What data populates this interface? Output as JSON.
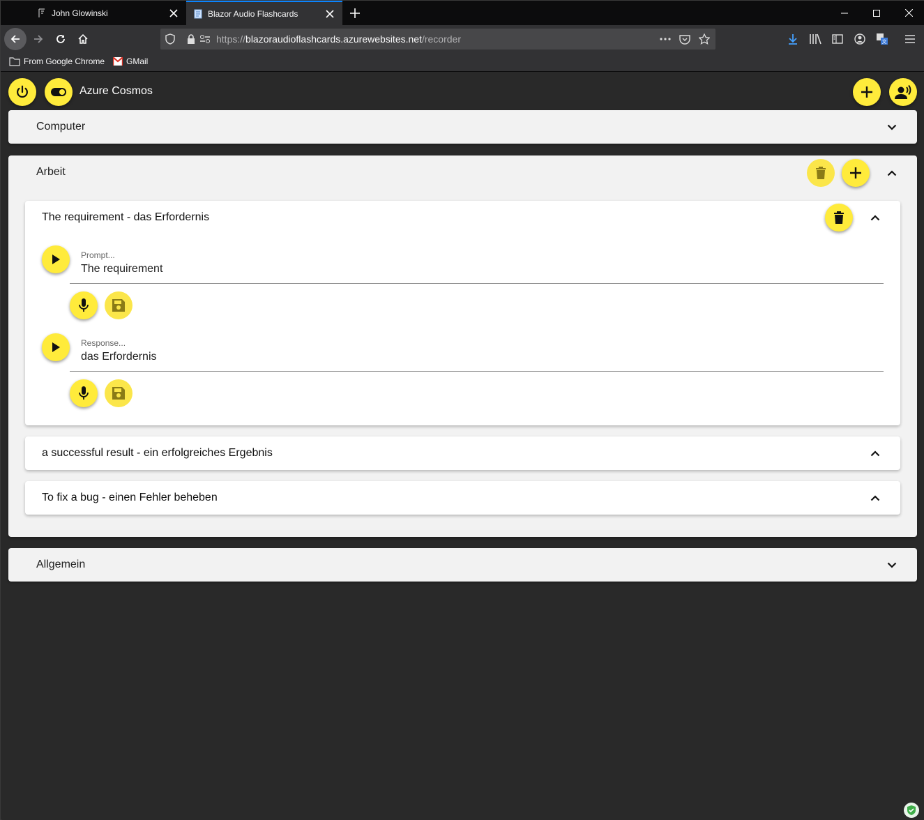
{
  "browser": {
    "tabs": [
      {
        "title": "John Glowinski",
        "active": false
      },
      {
        "title": "Blazor Audio Flashcards",
        "active": true
      }
    ],
    "url": {
      "scheme": "https://",
      "host": "blazoraudioflashcards.azurewebsites.net",
      "path": "/recorder"
    },
    "bookmarks": [
      {
        "label": "From Google Chrome",
        "icon": "folder-icon"
      },
      {
        "label": "GMail",
        "icon": "gmail-icon"
      }
    ],
    "accent_color": "#0a84ff"
  },
  "app": {
    "title": "Azure Cosmos",
    "accent_color": "#ffeb3b",
    "categories": [
      {
        "name": "Computer",
        "expanded": false
      },
      {
        "name": "Arbeit",
        "expanded": true,
        "cards": [
          {
            "title": "The requirement - das Erfordernis",
            "expanded": true,
            "prompt": {
              "label": "Prompt...",
              "value": "The requirement"
            },
            "response": {
              "label": "Response...",
              "value": "das Erfordernis"
            }
          },
          {
            "title": "a successful result - ein erfolgreiches Ergebnis",
            "expanded": false
          },
          {
            "title": "To fix a bug - einen Fehler beheben",
            "expanded": false
          }
        ]
      },
      {
        "name": "Allgemein",
        "expanded": false
      }
    ]
  }
}
